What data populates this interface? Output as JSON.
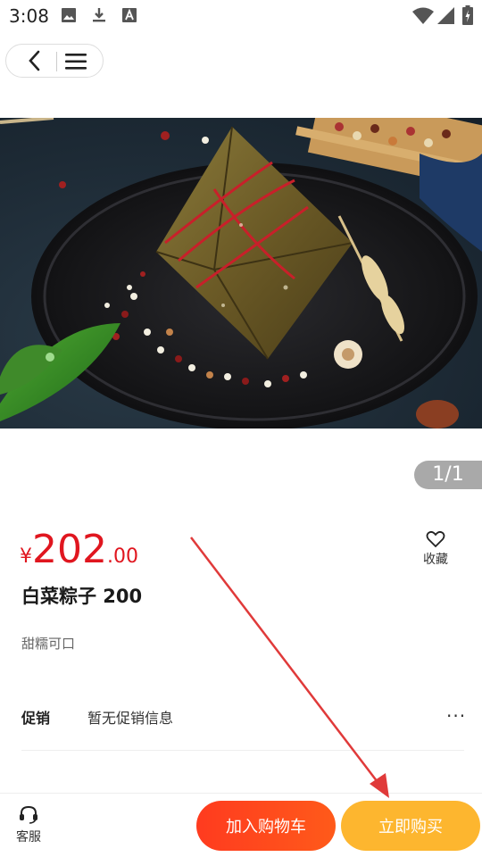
{
  "status_bar": {
    "time": "3:08"
  },
  "gallery": {
    "pager": "1/1"
  },
  "product": {
    "price_symbol": "¥",
    "price_integer": "202",
    "price_decimal": ".00",
    "favorite_label": "收藏",
    "title": "白菜粽子 200",
    "subtitle": "甜糯可口"
  },
  "promotion": {
    "label": "促销",
    "value": "暂无促销信息",
    "more": "···"
  },
  "bottom_bar": {
    "service_label": "客服",
    "add_to_cart": "加入购物车",
    "buy_now": "立即购买"
  },
  "colors": {
    "price": "#e0161f",
    "cart_button": "#ff3b1f",
    "buy_button": "#fdb62f",
    "annotation_arrow": "#e03a3a"
  },
  "icons": [
    "image-icon",
    "download-icon",
    "a-icon",
    "wifi-icon",
    "signal-icon",
    "battery-icon",
    "back-icon",
    "menu-icon",
    "heart-icon",
    "headset-icon"
  ]
}
